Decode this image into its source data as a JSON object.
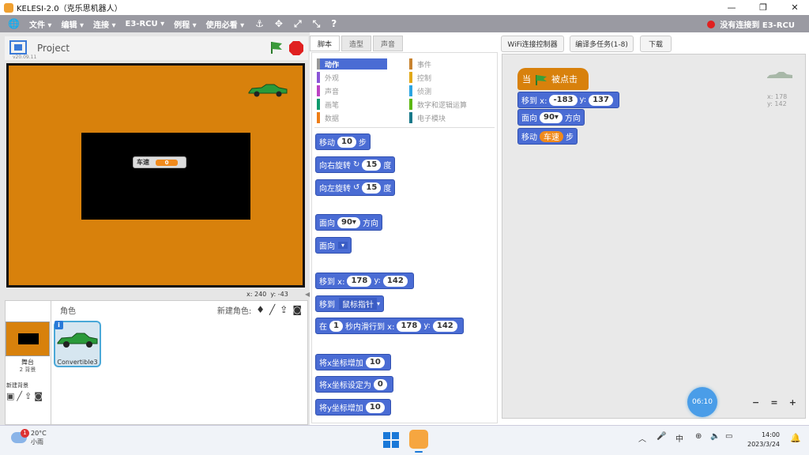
{
  "window": {
    "title": "KELESI-2.0（克乐思机器人）",
    "minimize": "—",
    "maximize": "❐",
    "close": "✕"
  },
  "menu": {
    "items": [
      "文件 ▾",
      "编辑 ▾",
      "连接 ▾",
      "E3-RCU ▾",
      "例程 ▾",
      "使用必看 ▾"
    ],
    "connection_status": "没有连接到 E3-RCU"
  },
  "stage": {
    "project_title": "Project",
    "version": "v20.09.11",
    "coords_x": "x: 240",
    "coords_y": "y: -43",
    "variable_label": "车速",
    "variable_value": "0"
  },
  "sprites": {
    "header": "角色",
    "new_sprite_label": "新建角色:",
    "stage_label": "舞台",
    "stage_backdrops": "2 背景",
    "new_backdrop_label": "新建背景",
    "sprite_name": "Convertible3",
    "info_icon": "i"
  },
  "tabs": [
    "脚本",
    "造型",
    "声音"
  ],
  "top_buttons": {
    "wifi": "WiFi连接控制器",
    "compile": "编译多任务(1-8)",
    "download": "下载"
  },
  "categories": {
    "left": [
      {
        "label": "动作",
        "color": "#4a6cd4"
      },
      {
        "label": "外观",
        "color": "#8a55d7"
      },
      {
        "label": "声音",
        "color": "#bb42c3"
      },
      {
        "label": "画笔",
        "color": "#0e9a6c"
      },
      {
        "label": "数据",
        "color": "#ee7d16"
      }
    ],
    "right": [
      {
        "label": "事件",
        "color": "#c88330"
      },
      {
        "label": "控制",
        "color": "#e1a91a"
      },
      {
        "label": "侦测",
        "color": "#2ca5e2"
      },
      {
        "label": "数字和逻辑运算",
        "color": "#5cb712"
      },
      {
        "label": "电子模块",
        "color": "#18798a"
      }
    ]
  },
  "blocks": {
    "move": {
      "a": "移动",
      "v": "10",
      "b": "步"
    },
    "turn_right": {
      "a": "向右旋转",
      "icon": "↻",
      "v": "15",
      "b": "度"
    },
    "turn_left": {
      "a": "向左旋转",
      "icon": "↺",
      "v": "15",
      "b": "度"
    },
    "point_dir": {
      "a": "面向",
      "v": "90",
      "b": "方向"
    },
    "point_towards": {
      "a": "面向"
    },
    "goto_xy": {
      "a": "移到 x:",
      "x": "178",
      "y_label": "y:",
      "y": "142"
    },
    "goto": {
      "a": "移到",
      "v": "鼠标指针"
    },
    "glide": {
      "a": "在",
      "v": "1",
      "b": "秒内滑行到 x:",
      "x": "178",
      "y_label": "y:",
      "y": "142"
    },
    "change_x": {
      "a": "将x坐标增加",
      "v": "10"
    },
    "set_x": {
      "a": "将x坐标设定为",
      "v": "0"
    },
    "change_y": {
      "a": "将y坐标增加",
      "v": "10"
    }
  },
  "script": {
    "hat": {
      "a": "当",
      "b": "被点击"
    },
    "goto": {
      "a": "移到 x:",
      "x": "-183",
      "y_label": "y:",
      "y": "137"
    },
    "point": {
      "a": "面向",
      "v": "90",
      "b": "方向"
    },
    "move": {
      "a": "移动",
      "v": "车速",
      "b": "步"
    }
  },
  "sprite_info": {
    "x": "x: 178",
    "y": "y: 142"
  },
  "timer": "06:10",
  "zoom": {
    "out": "−",
    "reset": "=",
    "in": "+"
  },
  "taskbar": {
    "temp": "20°C",
    "weather": "小雨",
    "badge": "1",
    "ime": "中",
    "time": "14:00",
    "date": "2023/3/24"
  }
}
